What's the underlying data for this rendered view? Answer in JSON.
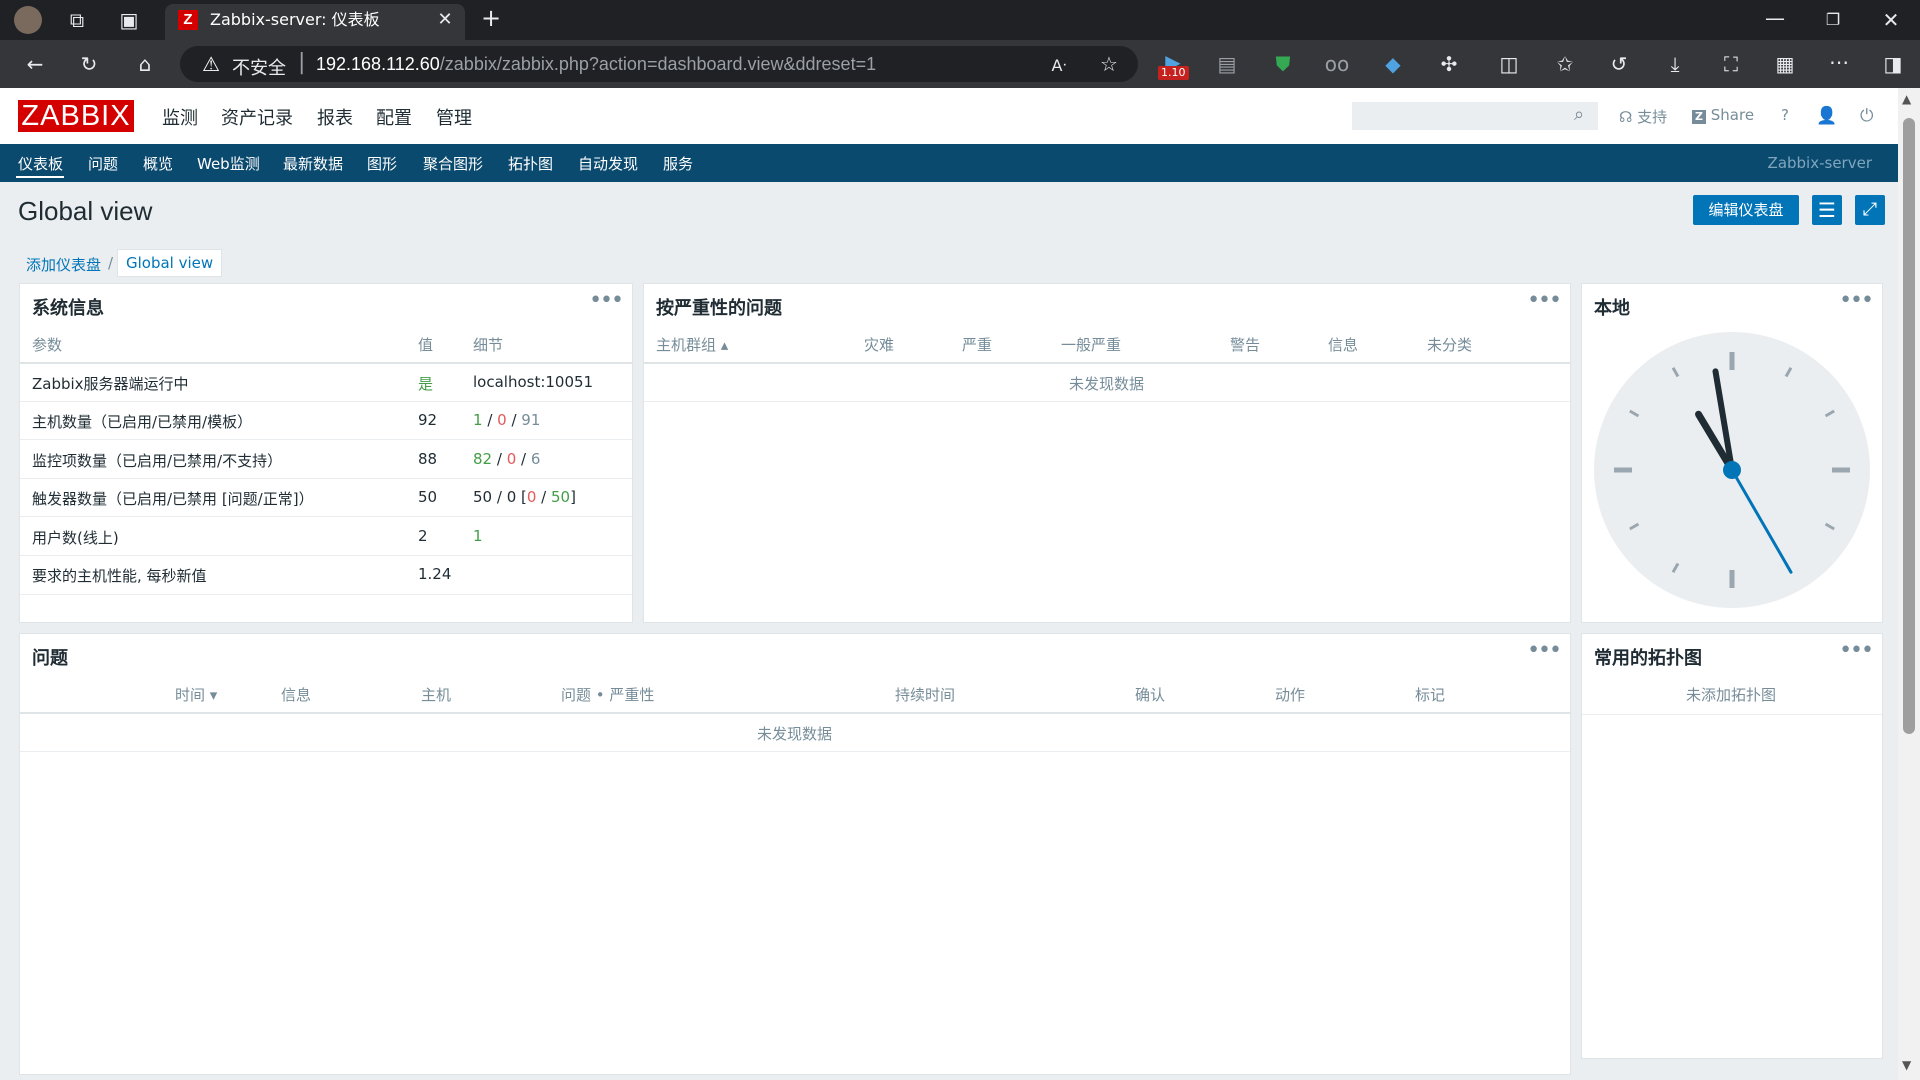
{
  "browser": {
    "tab_title": "Zabbix-server: 仪表板",
    "tab_favicon": "Z",
    "url_insecure": "不安全",
    "url_host": "192.168.112.60",
    "url_path": "/zabbix/zabbix.php?action=dashboard.view&ddreset=1",
    "extension_badge": "1.10"
  },
  "header": {
    "logo": "ZABBIX",
    "main_menu": [
      "监测",
      "资产记录",
      "报表",
      "配置",
      "管理"
    ],
    "support": "支持",
    "share": "Share",
    "help": "?"
  },
  "submenu": {
    "items": [
      "仪表板",
      "问题",
      "概览",
      "Web监测",
      "最新数据",
      "图形",
      "聚合图形",
      "拓扑图",
      "自动发现",
      "服务"
    ],
    "server_name": "Zabbix-server"
  },
  "page": {
    "title": "Global view",
    "edit_button": "编辑仪表盘",
    "breadcrumb": [
      "添加仪表盘",
      "Global view"
    ]
  },
  "sysinfo": {
    "title": "系统信息",
    "headers": [
      "参数",
      "值",
      "细节"
    ],
    "rows": [
      {
        "param": "Zabbix服务器端运行中",
        "value": "是",
        "detail": "localhost:10051"
      },
      {
        "param": "主机数量（已启用/已禁用/模板）",
        "value": "92",
        "d1": "1",
        "d2": "0",
        "d3": "91"
      },
      {
        "param": "监控项数量（已启用/已禁用/不支持）",
        "value": "88",
        "d1": "82",
        "d2": "0",
        "d3": "6"
      },
      {
        "param": "触发器数量（已启用/已禁用 [问题/正常]）",
        "value": "50",
        "d1": "50",
        "d2": "0",
        "d3": "0",
        "d4": "50"
      },
      {
        "param": "用户数(线上)",
        "value": "2",
        "d1": "1"
      },
      {
        "param": "要求的主机性能, 每秒新值",
        "value": "1.24"
      }
    ]
  },
  "severity": {
    "title": "按严重性的问题",
    "headers": [
      "主机群组 ▴",
      "灾难",
      "严重",
      "一般严重",
      "警告",
      "信息",
      "未分类"
    ],
    "empty": "未发现数据"
  },
  "clock": {
    "title": "本地",
    "hour": 10,
    "minute": 58,
    "second": 25
  },
  "problems": {
    "title": "问题",
    "headers": [
      "时间 ▾",
      "信息",
      "主机",
      "问题 • 严重性",
      "持续时间",
      "确认",
      "动作",
      "标记"
    ],
    "empty": "未发现数据"
  },
  "maps": {
    "title": "常用的拓扑图",
    "empty": "未添加拓扑图"
  }
}
